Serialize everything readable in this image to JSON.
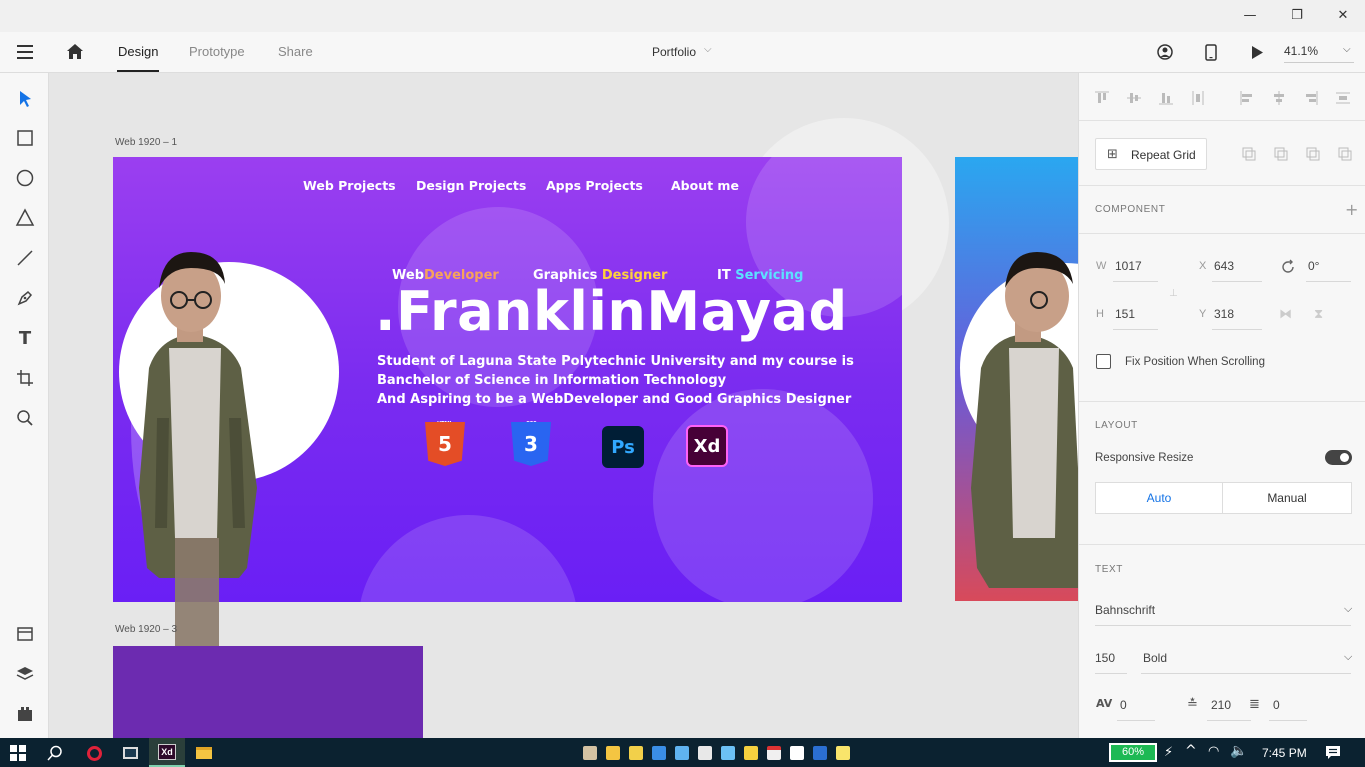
{
  "window": {
    "minimize": "—",
    "restore": "❐",
    "close": "✕"
  },
  "topbar": {
    "tabs": [
      {
        "label": "Design"
      },
      {
        "label": "Prototype"
      },
      {
        "label": "Share"
      }
    ],
    "document_title": "Portfolio",
    "zoom": "41.1%"
  },
  "canvas": {
    "artboard1_label": "Web 1920 – 1",
    "artboard3_label": "Web 1920 – 3",
    "site": {
      "nav": [
        "Web Projects",
        "Design Projects",
        "Apps Projects",
        "About me"
      ],
      "taglines": [
        {
          "a": "Web",
          "b": "Developer"
        },
        {
          "a": "Graphics ",
          "b": "Designer"
        },
        {
          "a": "IT ",
          "b": "Servicing"
        }
      ],
      "name": ".FranklinMayad",
      "description": [
        "Student of Laguna State Polytechnic University and my course is",
        "Banchelor of Science in Information Technology",
        "And Aspiring to be a WebDeveloper and Good Graphics Designer"
      ],
      "badges": {
        "html": "5",
        "html_tag": "HTML",
        "css": "3",
        "css_tag": "CSS",
        "ps": "Ps",
        "xd": "Xd"
      }
    }
  },
  "panel": {
    "repeat_grid": "Repeat Grid",
    "component_header": "COMPONENT",
    "transform": {
      "w_label": "W",
      "w": "1017",
      "x_label": "X",
      "x": "643",
      "h_label": "H",
      "h": "151",
      "y_label": "Y",
      "y": "318",
      "rotation": "0°"
    },
    "fix_position": "Fix Position When Scrolling",
    "layout_header": "LAYOUT",
    "responsive_resize": "Responsive Resize",
    "responsive_on": true,
    "resize_modes": [
      "Auto",
      "Manual"
    ],
    "text_header": "TEXT",
    "font_family": "Bahnschrift",
    "font_size": "150",
    "font_weight": "Bold",
    "char_spacing": "0",
    "line_spacing": "210",
    "para_spacing": "0"
  },
  "taskbar": {
    "battery": "60%",
    "time": "7:45 PM"
  },
  "colors": {
    "accent": "#1473e6",
    "artboard_top": "#9b3ff0",
    "artboard_bottom": "#6a1ff5",
    "taskbar": "#0b2230"
  }
}
